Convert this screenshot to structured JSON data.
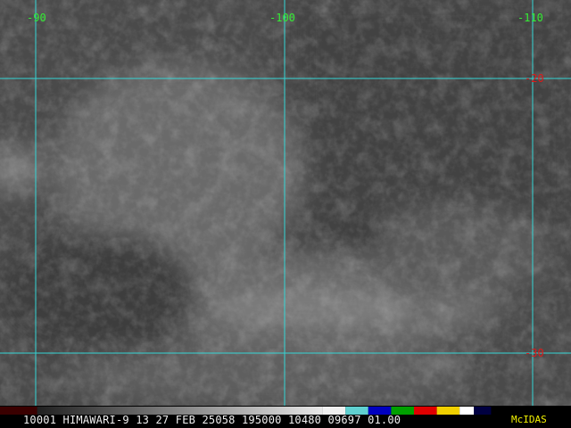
{
  "map": {
    "longitude_labels": [
      "-90",
      "-100",
      "-110"
    ],
    "latitude_labels": [
      "-20",
      "-30"
    ],
    "grid_color": "#34d6d6",
    "lon_label_color": "#33ee33",
    "lat_label_color": "#e01818"
  },
  "status": {
    "text": "10001 HIMAWARI-9 13 27 FEB 25058 195000 10480 09697 01.00",
    "brand": "McIDAS",
    "brand_color": "#f2f200"
  },
  "colorbar": {
    "segments": [
      {
        "color": "#3a0000",
        "span": 0.065
      },
      {
        "color": "#b0b0b0",
        "span": 0.5
      },
      {
        "color": "#f0f0f0",
        "span": 0.04
      },
      {
        "color": "#60d0d0",
        "span": 0.04
      },
      {
        "color": "#0000c0",
        "span": 0.04
      },
      {
        "color": "#00a000",
        "span": 0.04
      },
      {
        "color": "#e00000",
        "span": 0.04
      },
      {
        "color": "#f0d000",
        "span": 0.04
      },
      {
        "color": "#ffffff",
        "span": 0.025
      },
      {
        "color": "#000040",
        "span": 0.03
      }
    ]
  }
}
